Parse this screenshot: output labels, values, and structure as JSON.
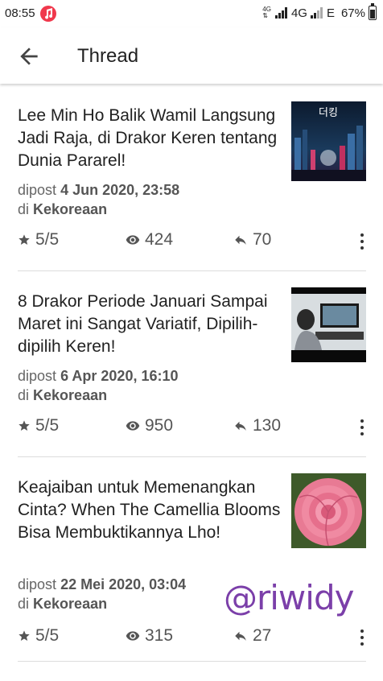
{
  "status": {
    "time": "08:55",
    "net1": "4G",
    "net2": "4G",
    "net3": "E",
    "battery": "67%",
    "battery_level": 0.67
  },
  "header": {
    "title": "Thread"
  },
  "threads": [
    {
      "title": "Lee Min Ho Balik Wamil Langsung Jadi Raja, di Drakor Keren tentang Dunia Pararel!",
      "posted_prefix": "dipost",
      "date": "4 Jun 2020, 23:58",
      "in_prefix": "di",
      "category": "Kekoreaan",
      "rating": "5/5",
      "views": "424",
      "replies": "70",
      "thumb_text": "더킹"
    },
    {
      "title": "8 Drakor Periode Januari Sampai Maret ini Sangat Variatif, Dipilih-dipilih Keren!",
      "posted_prefix": "dipost",
      "date": "6 Apr 2020, 16:10",
      "in_prefix": "di",
      "category": "Kekoreaan",
      "rating": "5/5",
      "views": "950",
      "replies": "130"
    },
    {
      "title": "Keajaiban untuk Memenangkan Cinta? When The Camellia Blooms Bisa Membuktikannya Lho!",
      "posted_prefix": "dipost",
      "date": "22 Mei 2020, 03:04",
      "in_prefix": "di",
      "category": "Kekoreaan",
      "rating": "5/5",
      "views": "315",
      "replies": "27"
    }
  ],
  "watermark": "@riwidy",
  "colors": {
    "accent_watermark": "#7b3fa9",
    "music_icon": "#f0384c"
  }
}
